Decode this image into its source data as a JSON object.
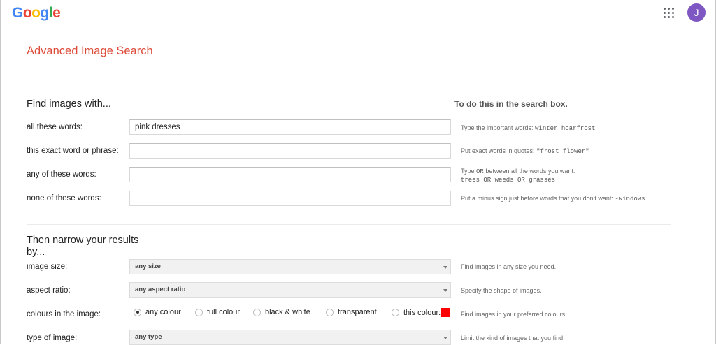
{
  "header": {
    "logo_letters": [
      {
        "ch": "G",
        "color": "#4285F4"
      },
      {
        "ch": "o",
        "color": "#EA4335"
      },
      {
        "ch": "o",
        "color": "#FBBC05"
      },
      {
        "ch": "g",
        "color": "#4285F4"
      },
      {
        "ch": "l",
        "color": "#34A853"
      },
      {
        "ch": "e",
        "color": "#EA4335"
      }
    ],
    "avatar_initial": "J",
    "apps_icon": "grid-apps-icon"
  },
  "page": {
    "title": "Advanced Image Search",
    "title_color": "#dd4b39"
  },
  "find": {
    "heading": "Find images with...",
    "hint_heading": "To do this in the search box.",
    "fields": [
      {
        "label": "all these words:",
        "value": "pink dresses",
        "hint_text": "Type the important words: ",
        "hint_code": "winter hoarfrost",
        "hint_text2": "",
        "hint_code2": ""
      },
      {
        "label": "this exact word or phrase:",
        "value": "",
        "hint_text": "Put exact words in quotes: ",
        "hint_code": "\"frost flower\"",
        "hint_text2": "",
        "hint_code2": ""
      },
      {
        "label": "any of these words:",
        "value": "",
        "hint_text": "Type ",
        "hint_code": "OR",
        "hint_text2": " between all the words you want:",
        "hint_code2": "trees OR weeds OR grasses"
      },
      {
        "label": "none of these words:",
        "value": "",
        "hint_text": "Put a minus sign just before words that you don't want: ",
        "hint_code": "-windows",
        "hint_text2": "",
        "hint_code2": ""
      }
    ]
  },
  "narrow": {
    "heading_line1": "Then narrow your results",
    "heading_line2": "by...",
    "image_size": {
      "label": "image size:",
      "value": "any size",
      "hint": "Find images in any size you need."
    },
    "aspect_ratio": {
      "label": "aspect ratio:",
      "value": "any aspect ratio",
      "hint": "Specify the shape of images."
    },
    "colours": {
      "label": "colours in the image:",
      "options": [
        "any colour",
        "full colour",
        "black & white",
        "transparent",
        "this colour:"
      ],
      "selected": "any colour",
      "swatch_color": "#ff0000",
      "hint": "Find images in your preferred colours."
    },
    "type_of_image": {
      "label": "type of image:",
      "value": "any type",
      "hint": "Limit the kind of images that you find."
    }
  }
}
